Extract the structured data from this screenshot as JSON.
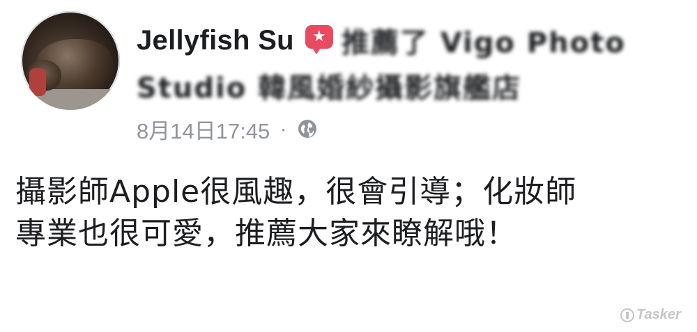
{
  "post": {
    "author": "Jellyfish Su",
    "recommend_icon": "recommend-icon",
    "recommend_color": "#e84a5f",
    "page_name_line1": "推薦了 Vigo Photo",
    "page_name_line2": "Studio 韓風婚紗攝影旗艦店",
    "timestamp": "8月14日17:45",
    "separator": "·",
    "privacy_icon": "globe-icon",
    "body_line1": "攝影師Apple很風趣，很會引導；化妝師",
    "body_line2": "專業也很可愛，推薦大家來瞭解哦！"
  },
  "watermark": {
    "text": "Tasker",
    "icon": "tasker-logo-icon"
  },
  "colors": {
    "meta_gray": "#90949c",
    "text_dark": "#1c1e21"
  }
}
